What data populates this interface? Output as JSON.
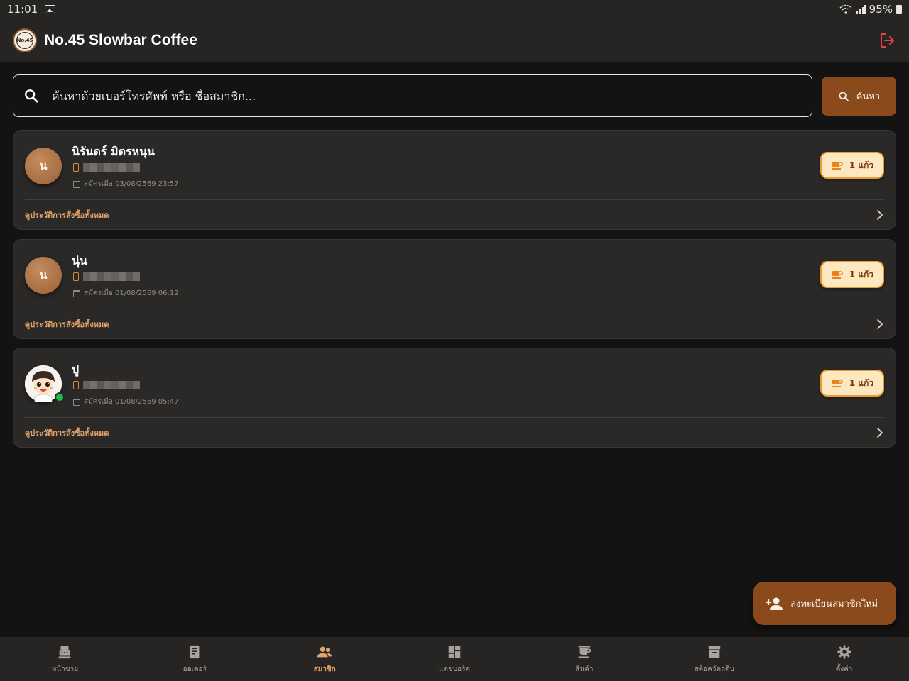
{
  "status_bar": {
    "time": "11:01",
    "battery": "95%"
  },
  "app": {
    "title": "No.45 Slowbar Coffee",
    "logo_text": "No.45"
  },
  "search": {
    "placeholder": "ค้นหาด้วยเบอร์โทรศัพท์ หรือ ชื่อสมาชิก...",
    "button_label": "ค้นหา"
  },
  "members": [
    {
      "name": "นิรันดร์ มิตรหนุน",
      "initial": "น",
      "registered": "สมัครเมื่อ 03/08/2569 23:57",
      "cups": "1 แก้ว",
      "history_label": "ดูประวัติการสั่งซื้อทั้งหมด"
    },
    {
      "name": "นุ่น",
      "initial": "น",
      "registered": "สมัครเมื่อ 01/08/2569 06:12",
      "cups": "1 แก้ว",
      "history_label": "ดูประวัติการสั่งซื้อทั้งหมด"
    },
    {
      "name": "ปู",
      "initial": "",
      "registered": "สมัครเมื่อ 01/08/2569 05:47",
      "cups": "1 แก้ว",
      "history_label": "ดูประวัติการสั่งซื้อทั้งหมด"
    }
  ],
  "fab": {
    "label": "ลงทะเบียนสมาชิกใหม่"
  },
  "nav": [
    {
      "label": "หน้าขาย",
      "icon": "cash-register-icon",
      "active": false
    },
    {
      "label": "ออเดอร์",
      "icon": "receipt-icon",
      "active": false
    },
    {
      "label": "สมาชิก",
      "icon": "people-icon",
      "active": true
    },
    {
      "label": "แดชบอร์ด",
      "icon": "dashboard-icon",
      "active": false
    },
    {
      "label": "สินค้า",
      "icon": "coffee-cup-icon",
      "active": false
    },
    {
      "label": "สต็อควัตถุดิบ",
      "icon": "archive-box-icon",
      "active": false
    },
    {
      "label": "ตั้งค่า",
      "icon": "gear-icon",
      "active": false
    }
  ],
  "colors": {
    "accent": "#8b4a1b",
    "accent_text": "#e2a36a",
    "badge_bg": "#fde8c2",
    "background": "#141313",
    "card": "#2b2927"
  }
}
